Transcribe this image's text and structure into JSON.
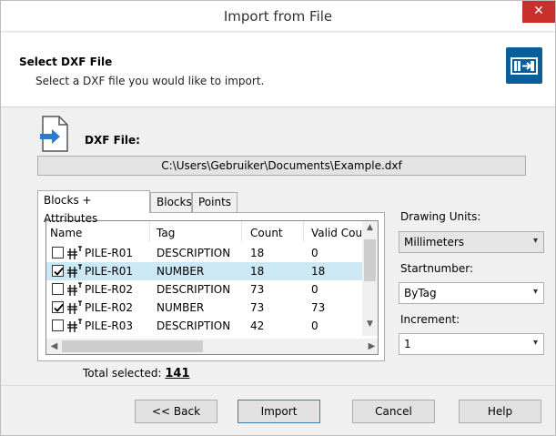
{
  "window": {
    "title": "Import from File",
    "close_glyph": "✕"
  },
  "header": {
    "title": "Select DXF File",
    "subtitle": "Select a DXF file you would like to import.",
    "logo_icon": "import-logo-icon",
    "accent_color": "#0b5e9c"
  },
  "file": {
    "label": "DXF File:",
    "path": "C:\\Users\\Gebruiker\\Documents\\Example.dxf"
  },
  "tabs": [
    {
      "label": "Blocks + Attributes",
      "active": true
    },
    {
      "label": "Blocks",
      "active": false
    },
    {
      "label": "Points",
      "active": false
    }
  ],
  "grid": {
    "columns": [
      "Name",
      "Tag",
      "Count",
      "Valid Count"
    ],
    "rows": [
      {
        "checked": false,
        "selected": false,
        "name": "PILE-R01",
        "tag": "DESCRIPTION",
        "count": "18",
        "valid": "0"
      },
      {
        "checked": true,
        "selected": true,
        "name": "PILE-R01",
        "tag": "NUMBER",
        "count": "18",
        "valid": "18"
      },
      {
        "checked": false,
        "selected": false,
        "name": "PILE-R02",
        "tag": "DESCRIPTION",
        "count": "73",
        "valid": "0"
      },
      {
        "checked": true,
        "selected": false,
        "name": "PILE-R02",
        "tag": "NUMBER",
        "count": "73",
        "valid": "73"
      },
      {
        "checked": false,
        "selected": false,
        "name": "PILE-R03",
        "tag": "DESCRIPTION",
        "count": "42",
        "valid": "0"
      }
    ],
    "selected_row_color": "#cce8f4"
  },
  "options": {
    "drawing_units_label": "Drawing Units:",
    "drawing_units_value": "Millimeters",
    "startnumber_label": "Startnumber:",
    "startnumber_value": "ByTag",
    "increment_label": "Increment:",
    "increment_value": "1"
  },
  "total": {
    "label": "Total selected:",
    "value": "141"
  },
  "buttons": {
    "back": "<< Back",
    "import": "Import",
    "cancel": "Cancel",
    "help": "Help"
  }
}
